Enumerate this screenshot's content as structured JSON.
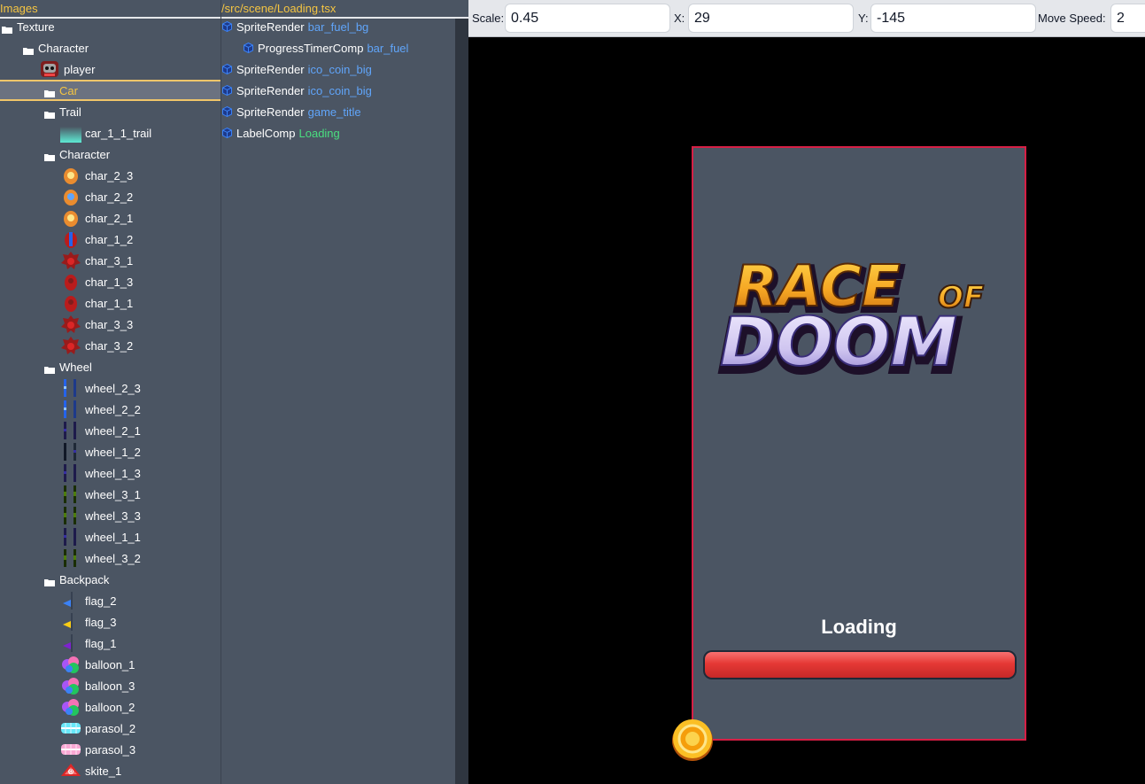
{
  "assets": {
    "title": "Images",
    "items": [
      {
        "label": "Texture",
        "kind": "folder",
        "indent": 0
      },
      {
        "label": "Character",
        "kind": "folder",
        "indent": 1
      },
      {
        "label": "player",
        "kind": "asset",
        "indent": 2,
        "thumb": "player-icon"
      },
      {
        "label": "Car",
        "kind": "folder",
        "indent": 2,
        "selected": true
      },
      {
        "label": "Trail",
        "kind": "folder",
        "indent": 2
      },
      {
        "label": "car_1_1_trail",
        "kind": "asset",
        "indent": 3,
        "thumb": "trail-icon"
      },
      {
        "label": "Character",
        "kind": "folder",
        "indent": 2
      },
      {
        "label": "char_2_3",
        "kind": "asset",
        "indent": 3,
        "thumb": "orange-char-icon"
      },
      {
        "label": "char_2_2",
        "kind": "asset",
        "indent": 3,
        "thumb": "orange-blue-char-icon"
      },
      {
        "label": "char_2_1",
        "kind": "asset",
        "indent": 3,
        "thumb": "orange-char-icon"
      },
      {
        "label": "char_1_2",
        "kind": "asset",
        "indent": 3,
        "thumb": "red-blue-char-icon"
      },
      {
        "label": "char_3_1",
        "kind": "asset",
        "indent": 3,
        "thumb": "red-spiky-char-icon"
      },
      {
        "label": "char_1_3",
        "kind": "asset",
        "indent": 3,
        "thumb": "red-char-icon"
      },
      {
        "label": "char_1_1",
        "kind": "asset",
        "indent": 3,
        "thumb": "red-char-icon"
      },
      {
        "label": "char_3_3",
        "kind": "asset",
        "indent": 3,
        "thumb": "red-spiky-char-icon"
      },
      {
        "label": "char_3_2",
        "kind": "asset",
        "indent": 3,
        "thumb": "red-spiky-char-icon"
      },
      {
        "label": "Wheel",
        "kind": "folder",
        "indent": 2
      },
      {
        "label": "wheel_2_3",
        "kind": "asset",
        "indent": 3,
        "thumb": "wheel-blue-icon"
      },
      {
        "label": "wheel_2_2",
        "kind": "asset",
        "indent": 3,
        "thumb": "wheel-blue-icon"
      },
      {
        "label": "wheel_2_1",
        "kind": "asset",
        "indent": 3,
        "thumb": "wheel-navy-icon"
      },
      {
        "label": "wheel_1_2",
        "kind": "asset",
        "indent": 3,
        "thumb": "wheel-dark-icon"
      },
      {
        "label": "wheel_1_3",
        "kind": "asset",
        "indent": 3,
        "thumb": "wheel-navy-icon"
      },
      {
        "label": "wheel_3_1",
        "kind": "asset",
        "indent": 3,
        "thumb": "wheel-green-icon"
      },
      {
        "label": "wheel_3_3",
        "kind": "asset",
        "indent": 3,
        "thumb": "wheel-green-icon"
      },
      {
        "label": "wheel_1_1",
        "kind": "asset",
        "indent": 3,
        "thumb": "wheel-navy-icon"
      },
      {
        "label": "wheel_3_2",
        "kind": "asset",
        "indent": 3,
        "thumb": "wheel-green-icon"
      },
      {
        "label": "Backpack",
        "kind": "folder",
        "indent": 2
      },
      {
        "label": "flag_2",
        "kind": "asset",
        "indent": 3,
        "thumb": "flag-blue-icon"
      },
      {
        "label": "flag_3",
        "kind": "asset",
        "indent": 3,
        "thumb": "flag-yellow-icon"
      },
      {
        "label": "flag_1",
        "kind": "asset",
        "indent": 3,
        "thumb": "flag-purple-icon"
      },
      {
        "label": "balloon_1",
        "kind": "asset",
        "indent": 3,
        "thumb": "balloon-icon"
      },
      {
        "label": "balloon_3",
        "kind": "asset",
        "indent": 3,
        "thumb": "balloon-icon"
      },
      {
        "label": "balloon_2",
        "kind": "asset",
        "indent": 3,
        "thumb": "balloon-icon"
      },
      {
        "label": "parasol_2",
        "kind": "asset",
        "indent": 3,
        "thumb": "parasol-blue-icon"
      },
      {
        "label": "parasol_3",
        "kind": "asset",
        "indent": 3,
        "thumb": "parasol-pink-icon"
      },
      {
        "label": "skite_1",
        "kind": "asset",
        "indent": 3,
        "thumb": "kite-icon"
      }
    ]
  },
  "hierarchy": {
    "title": "/src/scene/Loading.tsx",
    "nodes": [
      {
        "component": "SpriteRender",
        "name": "bar_fuel_bg",
        "depth": 0
      },
      {
        "component": "ProgressTimerComp",
        "name": "bar_fuel",
        "depth": 1
      },
      {
        "component": "SpriteRender",
        "name": "ico_coin_big",
        "depth": 0
      },
      {
        "component": "SpriteRender",
        "name": "ico_coin_big",
        "depth": 0
      },
      {
        "component": "SpriteRender",
        "name": "game_title",
        "depth": 0
      },
      {
        "component": "LabelComp",
        "name": "Loading",
        "depth": 0,
        "green": true
      }
    ]
  },
  "toolbar": {
    "scale_label": "Scale:",
    "scale_value": "0.45",
    "x_label": "X:",
    "x_value": "29",
    "y_label": "Y:",
    "y_value": "-145",
    "speed_label": "Move Speed:",
    "speed_value": "2"
  },
  "game": {
    "title_line1": "RACE",
    "title_of": "OF",
    "title_line2": "DOOM",
    "loading_text": "Loading",
    "progress": 1.0
  },
  "colors": {
    "panel_bg": "#4b5563",
    "accent_yellow": "#f5c542",
    "node_blue": "#60a5fa",
    "node_green": "#4ade80",
    "frame_border": "#d61f45",
    "bar_red": "#e53935"
  }
}
